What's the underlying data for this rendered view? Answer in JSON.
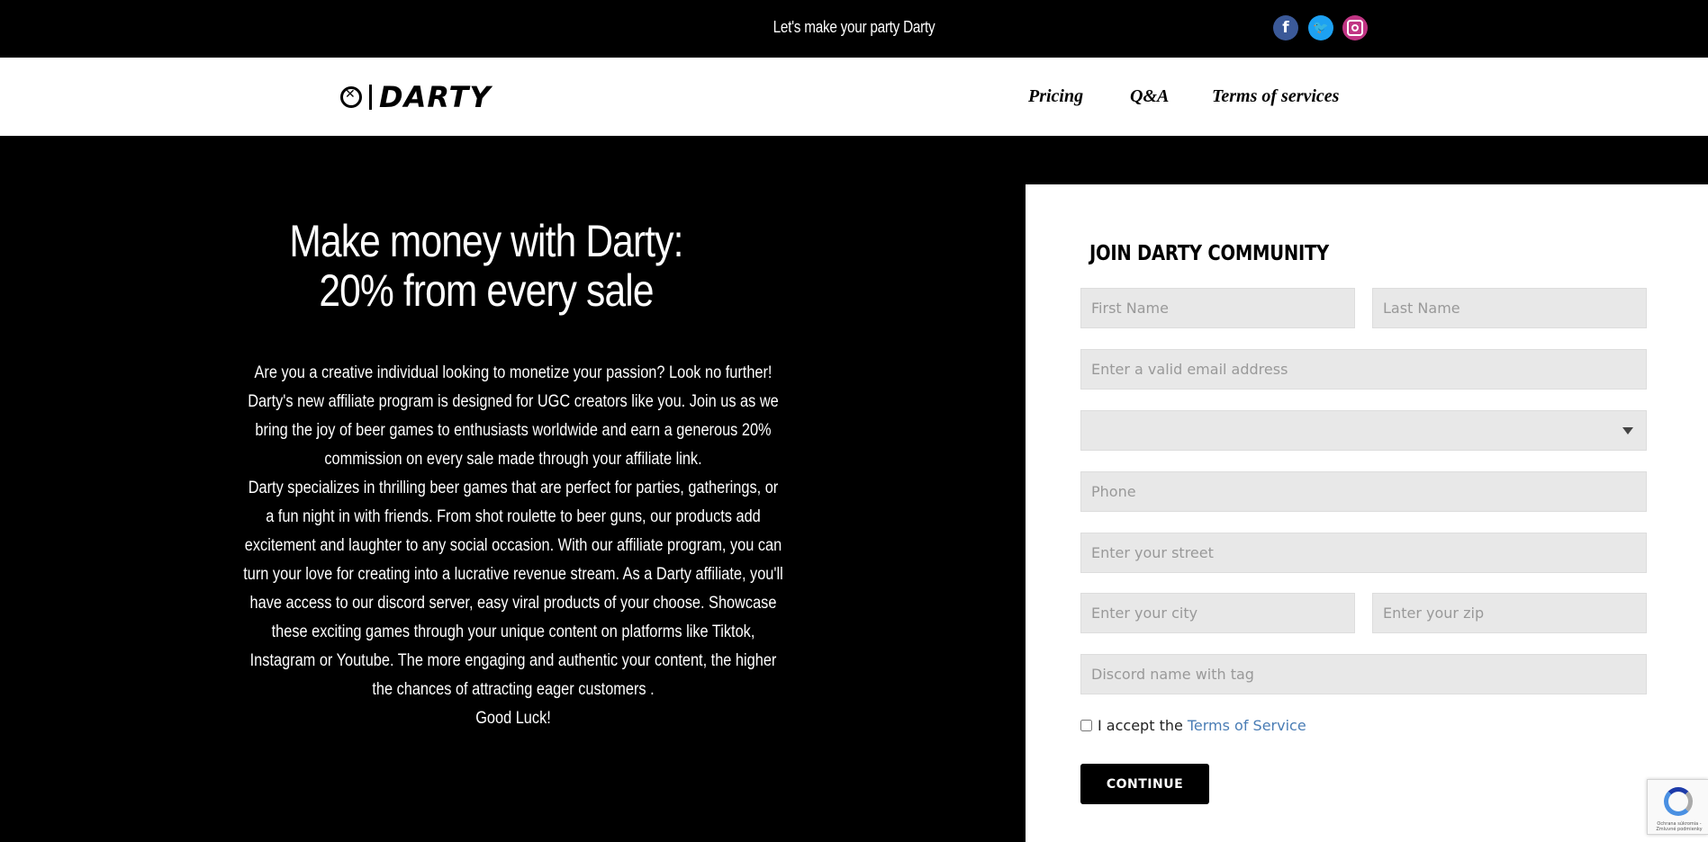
{
  "topbar": {
    "tagline": "Let's make your party Darty",
    "social": [
      {
        "name": "facebook-icon",
        "glyph": "f",
        "color": "#3b5998"
      },
      {
        "name": "twitter-icon",
        "glyph": "t",
        "color": "#1da1f2"
      },
      {
        "name": "instagram-icon",
        "glyph": "",
        "color": "#c13584"
      }
    ]
  },
  "nav": {
    "logo_text": "DARTY",
    "links": [
      "Pricing",
      "Q&A",
      "Terms of services"
    ]
  },
  "hero": {
    "headline_line1": "Make money with Darty:",
    "headline_line2": "20% from every sale",
    "paragraph1": "Are you a creative individual looking to monetize your passion? Look no further! Darty's new affiliate program is designed for UGC creators like you. Join us as we bring the joy of beer games to enthusiasts worldwide and earn a generous 20% commission on every sale made through your affiliate link.",
    "paragraph2": "Darty specializes in thrilling beer games that are perfect for parties, gatherings, or a fun night in with friends. From shot roulette to  beer guns, our products add excitement and laughter to any social occasion. With our affiliate program, you can turn your love for creating into a lucrative revenue stream. As a Darty affiliate, you'll have access to our discord server, easy viral products of your choose. Showcase these exciting games through your unique content on platforms like Tiktok, Instagram or Youtube. The more engaging and authentic your content, the higher the chances of attracting eager customers .",
    "paragraph3": "Good Luck!"
  },
  "form": {
    "title": "JOIN DARTY COMMUNITY",
    "first_name_placeholder": "First Name",
    "last_name_placeholder": "Last Name",
    "email_placeholder": "Enter a valid email address",
    "select_value": "",
    "phone_placeholder": "Phone",
    "street_placeholder": "Enter your street",
    "city_placeholder": "Enter your city",
    "zip_placeholder": "Enter your zip",
    "discord_placeholder": "Discord name with tag",
    "accept_text": "I accept the",
    "accept_link": "Terms of Service",
    "continue_label": "CONTINUE"
  },
  "recaptcha": {
    "text": "Ochrana súkromia - Zmluvné podmienky"
  },
  "colors": {
    "background": "#000000",
    "form_bg": "#ffffff",
    "field_bg": "#e8e8e8",
    "link": "#4a7db5"
  }
}
